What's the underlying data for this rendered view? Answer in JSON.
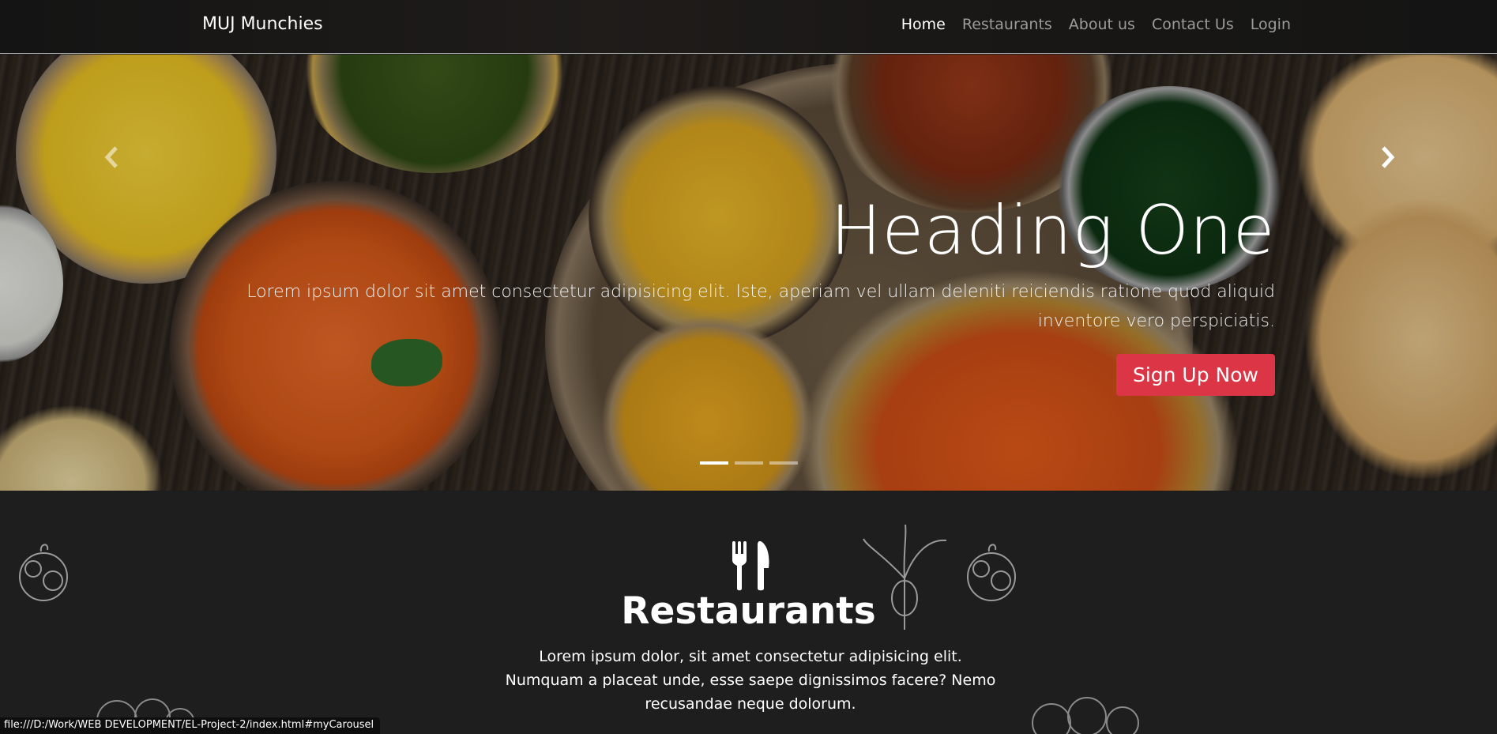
{
  "navbar": {
    "brand": "MUJ Munchies",
    "links": [
      "Home",
      "Restaurants",
      "About us",
      "Contact Us",
      "Login"
    ]
  },
  "carousel": {
    "heading": "Heading One",
    "text": "Lorem ipsum dolor sit amet consectetur adipisicing elit. Iste, aperiam vel ullam deleniti reiciendis ratione quod aliquid inventore vero perspiciatis.",
    "button": "Sign Up Now",
    "slide_count": 3,
    "active_slide": 1,
    "prev_icon": "chevron-left-icon",
    "next_icon": "chevron-right-icon"
  },
  "restaurants_section": {
    "icon": "fork-knife-icon",
    "title": "Restaurants",
    "text": "Lorem ipsum dolor, sit amet consectetur adipisicing elit. Numquam a placeat unde, esse saepe dignissimos facere? Nemo recusandae neque dolorum."
  },
  "status_bar": {
    "url": "file:///D:/Work/WEB DEVELOPMENT/EL-Project-2/index.html#myCarousel"
  },
  "colors": {
    "accent_button": "#dc3545",
    "navbar_bg": "#161616",
    "section_bg": "#1e1e1e"
  }
}
